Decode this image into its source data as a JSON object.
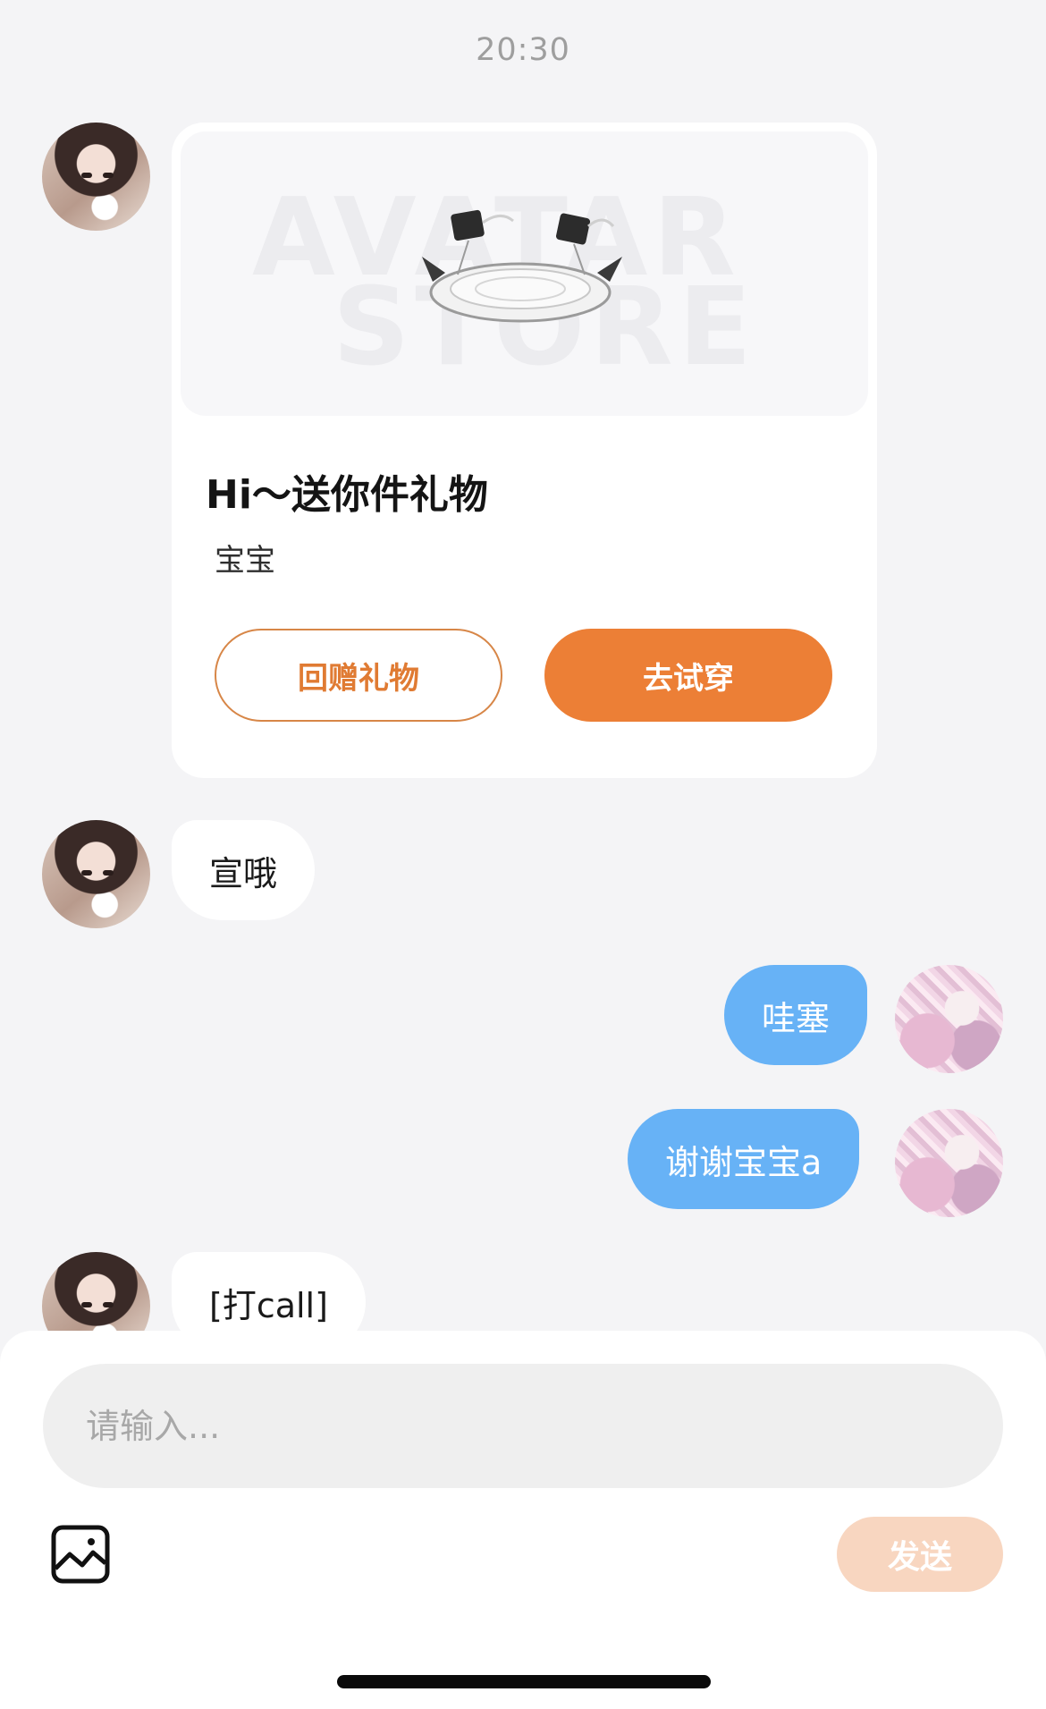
{
  "timestamp": "20:30",
  "gift_card": {
    "title": "Hi～送你件礼物",
    "subtitle": "宝宝",
    "banner_watermark_top": "AVATAR",
    "banner_watermark_bottom": "STORE",
    "return_gift_label": "回赠礼物",
    "try_on_label": "去试穿"
  },
  "messages": [
    {
      "side": "in",
      "text": "宣哦"
    },
    {
      "side": "out",
      "text": "哇塞"
    },
    {
      "side": "out",
      "text": "谢谢宝宝a"
    },
    {
      "side": "in",
      "text": "[打call]"
    }
  ],
  "composer": {
    "placeholder": "请输入...",
    "send_label": "发送",
    "image_icon": "image-icon"
  },
  "colors": {
    "accent_orange": "#ec7f36",
    "outgoing_bubble": "#67b2f6",
    "send_disabled": "#f8d6c0"
  }
}
